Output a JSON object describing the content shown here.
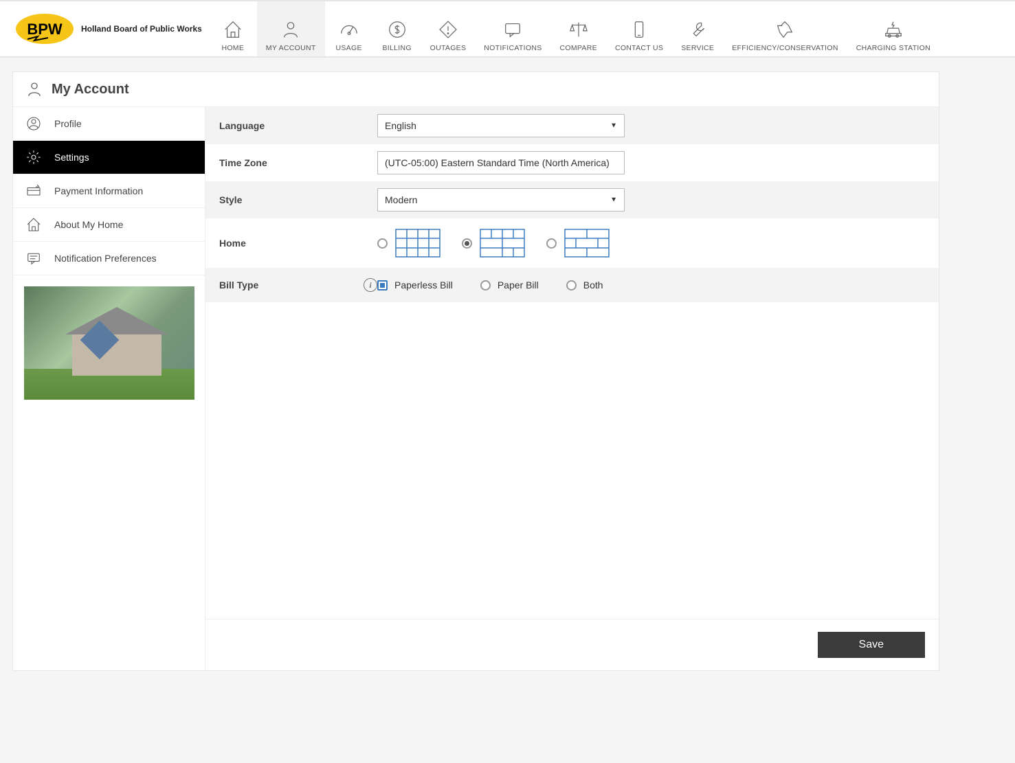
{
  "brand": {
    "name": "Holland Board of Public Works",
    "logo_text": "BPW"
  },
  "nav": {
    "items": [
      {
        "id": "home",
        "label": "HOME"
      },
      {
        "id": "account",
        "label": "MY ACCOUNT",
        "active": true
      },
      {
        "id": "usage",
        "label": "USAGE"
      },
      {
        "id": "billing",
        "label": "BILLING"
      },
      {
        "id": "outages",
        "label": "OUTAGES"
      },
      {
        "id": "notifications",
        "label": "NOTIFICATIONS"
      },
      {
        "id": "compare",
        "label": "COMPARE"
      },
      {
        "id": "contact",
        "label": "CONTACT US"
      },
      {
        "id": "service",
        "label": "SERVICE"
      },
      {
        "id": "efficiency",
        "label": "EFFICIENCY/CONSERVATION"
      },
      {
        "id": "charging",
        "label": "CHARGING STATION"
      }
    ]
  },
  "page_title": "My Account",
  "sidebar": {
    "items": [
      {
        "id": "profile",
        "label": "Profile"
      },
      {
        "id": "settings",
        "label": "Settings",
        "active": true
      },
      {
        "id": "payment",
        "label": "Payment Information"
      },
      {
        "id": "home",
        "label": "About My Home"
      },
      {
        "id": "notif",
        "label": "Notification Preferences"
      }
    ]
  },
  "form": {
    "language": {
      "label": "Language",
      "value": "English"
    },
    "timezone": {
      "label": "Time Zone",
      "value": "(UTC-05:00) Eastern Standard Time (North America)"
    },
    "style": {
      "label": "Style",
      "value": "Modern"
    },
    "home_layout": {
      "label": "Home",
      "selected_index": 1
    },
    "bill_type": {
      "label": "Bill Type",
      "selected": "paperless",
      "options": [
        {
          "id": "paperless",
          "label": "Paperless Bill"
        },
        {
          "id": "paper",
          "label": "Paper Bill"
        },
        {
          "id": "both",
          "label": "Both"
        }
      ]
    },
    "save_label": "Save"
  }
}
